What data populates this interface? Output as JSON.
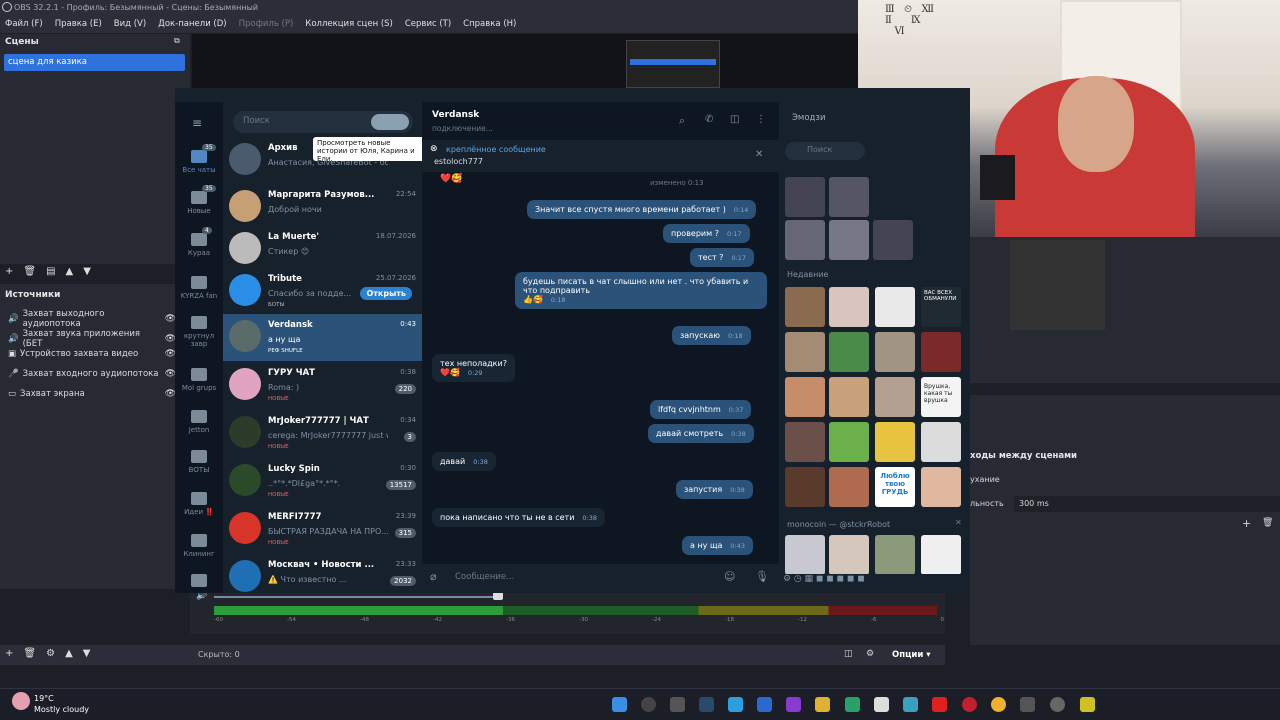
{
  "obs": {
    "title": "OBS 32.2.1 - Профиль: Безымянный - Сцены: Безымянный",
    "menu": [
      {
        "label": "Файл (F)"
      },
      {
        "label": "Правка (E)"
      },
      {
        "label": "Вид (V)"
      },
      {
        "label": "Док-панели (D)"
      },
      {
        "label": "Профиль (P)"
      },
      {
        "label": "Коллекция сцен (S)"
      },
      {
        "label": "Сервис (T)"
      },
      {
        "label": "Справка (H)"
      }
    ],
    "scenes_title": "Сцены",
    "scene_selected": "сцена для казика",
    "sources_title": "Источники",
    "sources": [
      {
        "label": "Захват выходного аудиопотока"
      },
      {
        "label": "Захват звука приложения (БЕТ"
      },
      {
        "label": "Устройство захвата видео"
      },
      {
        "label": "Захват входного аудиопотока"
      },
      {
        "label": "Захват экрана"
      }
    ],
    "meter_ticks": [
      "-60",
      "-54",
      "-48",
      "-42",
      "-36",
      "-30",
      "-24",
      "-18",
      "-12",
      "-6",
      "0"
    ],
    "status": "Скрыто: 0",
    "options_label": "Опции",
    "transitions_title": "ходы между сценами",
    "transition_type": "ухание",
    "transition_duration_label": "льность",
    "transition_duration": "300 ms"
  },
  "tg": {
    "search_placeholder": "Поиск",
    "folders": [
      {
        "label": "Все чаты",
        "badge": "35"
      },
      {
        "label": "Новые",
        "badge": "35"
      },
      {
        "label": "Кураа",
        "badge": "4"
      },
      {
        "label": "KYRZA fan"
      },
      {
        "label": "крутнул завр"
      },
      {
        "label": "Moi grups"
      },
      {
        "label": "Jetton"
      },
      {
        "label": "ВОТЫ"
      },
      {
        "label": "Идеи ‼️"
      },
      {
        "label": "Клининг"
      }
    ],
    "archive_tooltip": "Просмотреть новые истории от Юля, Карина и Ели.",
    "chats": [
      {
        "name": "Архив",
        "preview": "Анастасия, GiveShareBot - бот для ...",
        "time": "",
        "badge": "",
        "tag": ""
      },
      {
        "name": "Маргарита Разумов...",
        "preview": "Доброй ночи",
        "time": "22:54",
        "badge": "",
        "tag": ""
      },
      {
        "name": "La Muerte'",
        "preview": "Стикер 😊",
        "time": "18.07.2026",
        "badge": "",
        "tag": ""
      },
      {
        "name": "Tribute",
        "preview": "Спасибо за подде...",
        "time": "25.07.2026",
        "badge": "",
        "tag": "БОТЫ",
        "action": "Открыть"
      },
      {
        "name": "Verdansk",
        "preview": "а ну ща",
        "time": "0:43",
        "badge": "",
        "tag": "РЕФ SHUFLE"
      },
      {
        "name": "ГУРУ ЧАТ",
        "preview": "Roma: )",
        "time": "0:38",
        "badge": "220",
        "tag": "НОВЫЕ"
      },
      {
        "name": "MrJoker777777 | ЧАТ",
        "preview": "cerega: MrJoker7777777 just w...",
        "time": "0:34",
        "badge": "3",
        "tag": "НОВЫЕ"
      },
      {
        "name": "Lucky Spin",
        "preview": "..*°*.*Dl£ga°*.*°*.",
        "time": "0:30",
        "badge": "13517",
        "tag": "НОВЫЕ"
      },
      {
        "name": "MERFI7777",
        "preview": "БЫСТРАЯ РАЗДАЧА НА ПРО...",
        "time": "23:39",
        "badge": "315",
        "tag": "НОВЫЕ"
      },
      {
        "name": "Москвач • Новости ...",
        "preview": "⚠️ Что известно ...",
        "time": "23:33",
        "badge": "2032",
        "tag": "НОВЫЕ"
      }
    ],
    "chat_title": "Verdansk",
    "chat_status": "подключение...",
    "pinned_label": "креплённое сообщение",
    "pinned_text": "estoloch777",
    "edited": "изменено 0:13",
    "messages": [
      {
        "text": "Значит все спустя много времени работает )",
        "time": "0:14"
      },
      {
        "text": "проверим ?",
        "time": "0:17"
      },
      {
        "text": "тест ?",
        "time": "0:17"
      },
      {
        "text": "будешь писать в чат слышно или нет . что убавить и что подправить",
        "time": "0:18"
      },
      {
        "text": "запускаю",
        "time": "0:18"
      },
      {
        "text": "тех неполадки?",
        "time": "0:29"
      },
      {
        "text": "lfdfq cvvjnhtnm",
        "time": "0:37"
      },
      {
        "text": "давай смотреть",
        "time": "0:38"
      },
      {
        "text": "давай",
        "time": "0:38"
      },
      {
        "text": "запустия",
        "time": "0:38"
      },
      {
        "text": "пока написано что ты не в сети",
        "time": "0:38"
      },
      {
        "text": "а ну ща",
        "time": "0:43"
      }
    ],
    "input_placeholder": "Сообщение...",
    "emoji_tab": "Эмодзи",
    "emoji_search": "Поиск",
    "recent_label": "Недавние",
    "pack_label": "monocoin — @stckrRobot",
    "sticker_texts": [
      "ВАС ВСЕХ ОБМАНУЛИ",
      "Врушка, какая ты врушка",
      "Люблю твою ГРУДЬ"
    ]
  },
  "weather": {
    "temp": "19°C",
    "desc": "Mostly cloudy"
  }
}
